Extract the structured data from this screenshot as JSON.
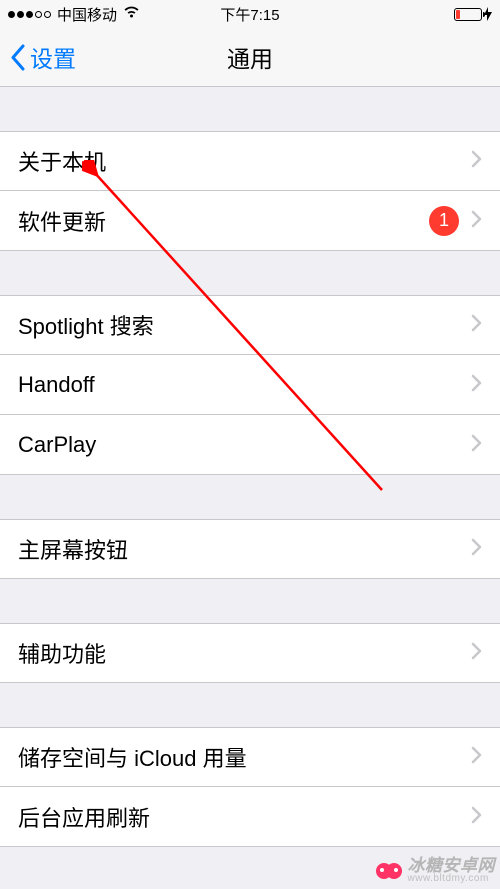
{
  "statusBar": {
    "carrier": "中国移动",
    "time": "下午7:15"
  },
  "nav": {
    "back": "设置",
    "title": "通用"
  },
  "groups": [
    {
      "rows": [
        {
          "label": "关于本机",
          "badge": null
        },
        {
          "label": "软件更新",
          "badge": "1"
        }
      ]
    },
    {
      "rows": [
        {
          "label": "Spotlight 搜索",
          "badge": null
        },
        {
          "label": "Handoff",
          "badge": null
        },
        {
          "label": "CarPlay",
          "badge": null
        }
      ]
    },
    {
      "rows": [
        {
          "label": "主屏幕按钮",
          "badge": null
        }
      ]
    },
    {
      "rows": [
        {
          "label": "辅助功能",
          "badge": null
        }
      ]
    },
    {
      "rows": [
        {
          "label": "储存空间与 iCloud 用量",
          "badge": null
        },
        {
          "label": "后台应用刷新",
          "badge": null
        }
      ]
    }
  ],
  "watermark": {
    "text": "冰糖安卓网",
    "url": "www.bltdmy.com"
  }
}
